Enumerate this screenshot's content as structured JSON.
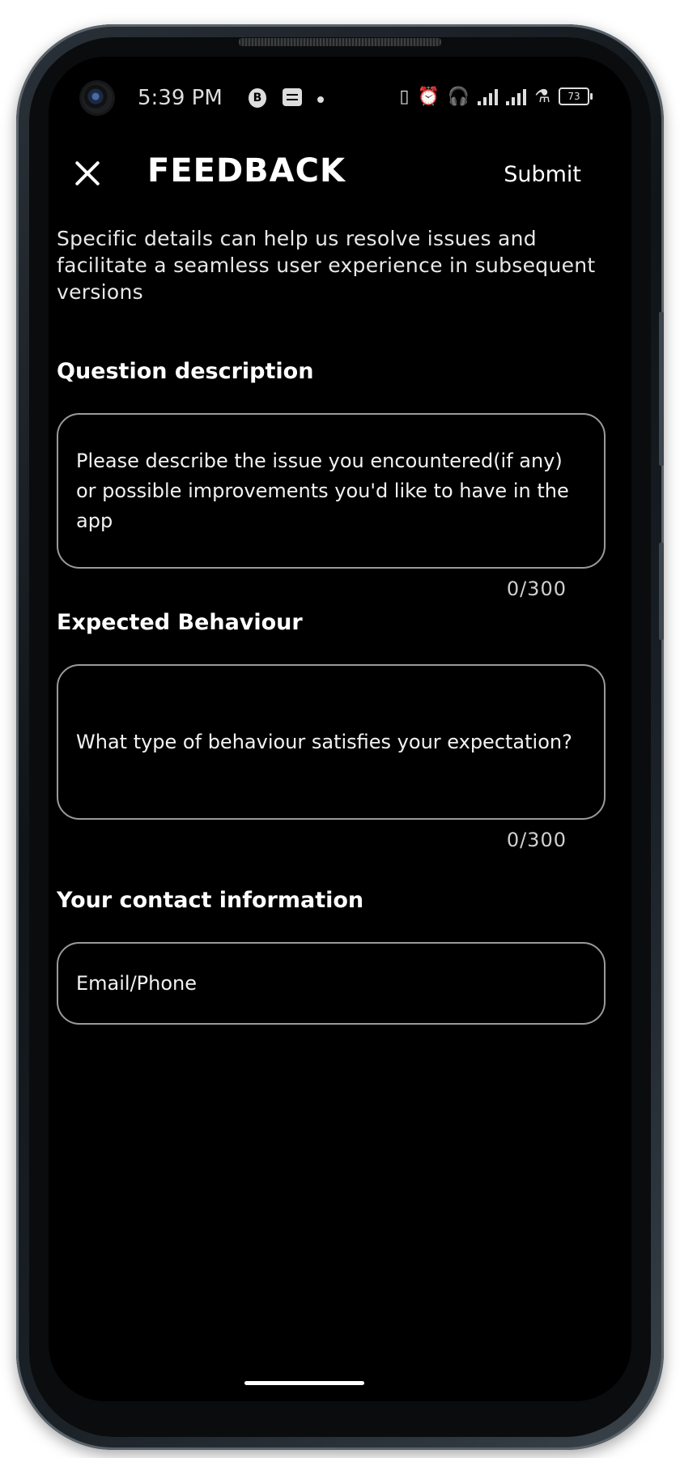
{
  "status_bar": {
    "time": "5:39 PM",
    "battery": "73",
    "icons": [
      "camera-icon",
      "b-badge-icon",
      "notes-icon",
      "dot-icon",
      "vibrate-icon",
      "alarm-icon",
      "headset-icon",
      "signal-icon",
      "signal-icon",
      "flask-icon",
      "battery-icon"
    ]
  },
  "header": {
    "title": "FEEDBACK",
    "submit_label": "Submit",
    "close_icon": "close-icon"
  },
  "intro": "Specific details can help us resolve issues and facilitate a seamless user experience in subsequent versions",
  "question": {
    "label": "Question description",
    "placeholder": "Please describe the issue you encountered(if any) or possible improvements you'd like to have in the app",
    "counter": "0/300"
  },
  "expected": {
    "label": "Expected Behaviour",
    "placeholder": "What type of behaviour satisfies your expectation?",
    "counter": "0/300"
  },
  "contact": {
    "label": "Your contact information",
    "placeholder": "Email/Phone"
  }
}
